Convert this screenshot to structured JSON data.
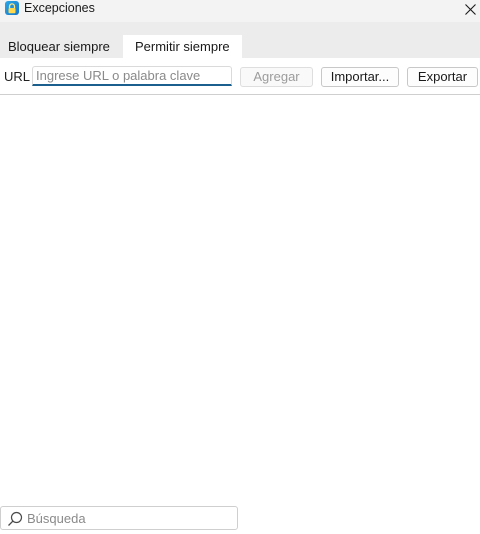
{
  "window": {
    "title": "Excepciones",
    "icons": {
      "app": "lock-app-icon",
      "close": "close-icon"
    }
  },
  "tabs": [
    {
      "label": "Bloquear siempre",
      "active": false
    },
    {
      "label": "Permitir siempre",
      "active": true
    }
  ],
  "toolbar": {
    "url_label": "URL",
    "url_placeholder": "Ingrese URL o palabra clave",
    "url_value": "",
    "add_label": "Agregar",
    "add_enabled": false,
    "import_label": "Importar...",
    "export_label": "Exportar"
  },
  "list": {
    "items": []
  },
  "search": {
    "placeholder": "Búsqueda",
    "value": "",
    "icon": "search-icon"
  },
  "colors": {
    "accent": "#1b5f8e",
    "tabbar_bg": "#ececec",
    "titlebar_bg": "#f3f3f3",
    "app_icon": "#1f8fd8"
  }
}
